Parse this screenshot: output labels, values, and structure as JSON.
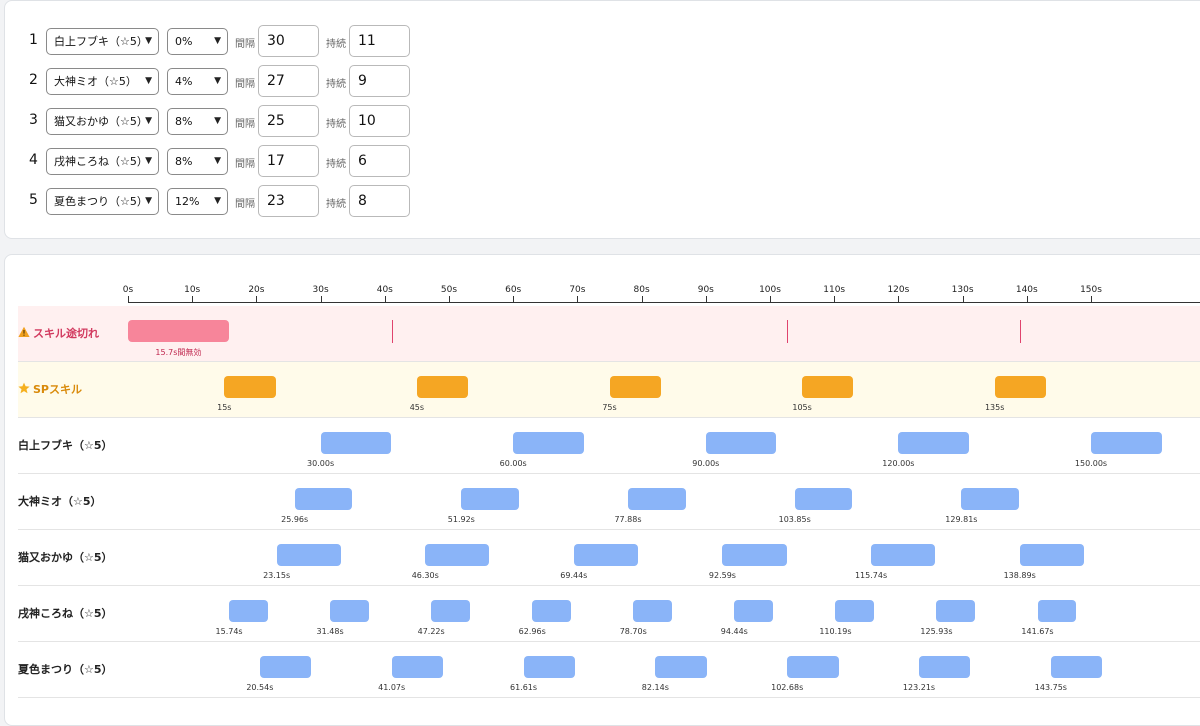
{
  "config": {
    "interval_label": "間隔",
    "duration_label": "持続",
    "rows": [
      {
        "num": "1",
        "character": "白上フブキ（☆5）",
        "rate": "0%",
        "interval": "30",
        "duration": "11"
      },
      {
        "num": "2",
        "character": "大神ミオ（☆5）",
        "rate": "4%",
        "interval": "27",
        "duration": "9"
      },
      {
        "num": "3",
        "character": "猫又おかゆ（☆5）",
        "rate": "8%",
        "interval": "25",
        "duration": "10"
      },
      {
        "num": "4",
        "character": "戌神ころね（☆5）",
        "rate": "8%",
        "interval": "17",
        "duration": "6"
      },
      {
        "num": "5",
        "character": "夏色まつり（☆5）",
        "rate": "12%",
        "interval": "23",
        "duration": "8"
      }
    ]
  },
  "timeline": {
    "axis_ticks": [
      "0s",
      "10s",
      "20s",
      "30s",
      "40s",
      "50s",
      "60s",
      "70s",
      "80s",
      "90s",
      "100s",
      "110s",
      "120s",
      "130s",
      "140s",
      "150s"
    ],
    "gap_lane": {
      "label": "スキル途切れ",
      "icon": "warning-icon",
      "color": "#f7859a",
      "background": "#fff0f0",
      "blocks": [
        {
          "start": 0,
          "end": 15.7,
          "label": "15.7s間無効"
        }
      ],
      "marks": [
        41.07,
        102.68,
        138.89
      ]
    },
    "sp_lane": {
      "label": "SPスキル",
      "icon": "star-icon",
      "color": "#f5a623",
      "background": "#fffbea",
      "bars": [
        {
          "start": 15,
          "label": "15s"
        },
        {
          "start": 45,
          "label": "45s"
        },
        {
          "start": 75,
          "label": "75s"
        },
        {
          "start": 105,
          "label": "105s"
        },
        {
          "start": 135,
          "label": "135s"
        }
      ],
      "duration": 8
    },
    "character_color": "#8ab4f8",
    "characters": [
      {
        "name": "白上フブキ（☆5）",
        "duration": 11,
        "starts": [
          "30.00s",
          "60.00s",
          "90.00s",
          "120.00s",
          "150.00s"
        ]
      },
      {
        "name": "大神ミオ（☆5）",
        "duration": 9,
        "starts": [
          "25.96s",
          "51.92s",
          "77.88s",
          "103.85s",
          "129.81s"
        ]
      },
      {
        "name": "猫又おかゆ（☆5）",
        "duration": 10,
        "starts": [
          "23.15s",
          "46.30s",
          "69.44s",
          "92.59s",
          "115.74s",
          "138.89s"
        ]
      },
      {
        "name": "戌神ころね（☆5）",
        "duration": 6,
        "starts": [
          "15.74s",
          "31.48s",
          "47.22s",
          "62.96s",
          "78.70s",
          "94.44s",
          "110.19s",
          "125.93s",
          "141.67s"
        ]
      },
      {
        "name": "夏色まつり（☆5）",
        "duration": 8,
        "starts": [
          "20.54s",
          "41.07s",
          "61.61s",
          "82.14s",
          "102.68s",
          "123.21s",
          "143.75s"
        ]
      }
    ]
  }
}
